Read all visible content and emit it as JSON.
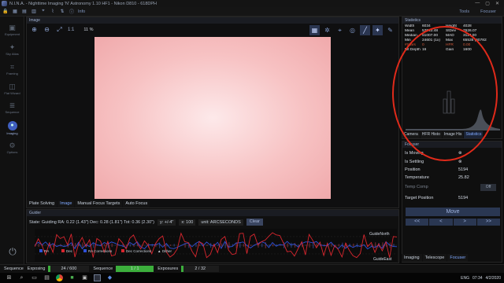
{
  "window": {
    "title": "N.I.N.A. - Nighttime Imaging 'N' Astronomy 1.10 HF1 - Nikon D810 - 618DPH",
    "min": "—",
    "max": "▢",
    "close": "✕"
  },
  "toolbar": {
    "info_label": "Info",
    "tools_label": "Tools",
    "right_label": "Focuser"
  },
  "nav": [
    {
      "label": "Equipment",
      "icon": "camera-icon"
    },
    {
      "label": "Sky Atlas",
      "icon": "atlas-icon"
    },
    {
      "label": "Framing",
      "icon": "framing-icon"
    },
    {
      "label": "Flat Wizard",
      "icon": "flat-icon"
    },
    {
      "label": "Sequence",
      "icon": "sequence-icon"
    },
    {
      "label": "Imaging",
      "icon": "imaging-icon"
    },
    {
      "label": "Options",
      "icon": "gear-icon"
    }
  ],
  "image_panel": {
    "header": "Image",
    "ratio": "1:1",
    "zoom": "11 %",
    "tabs": [
      "Plate Solving",
      "Image",
      "Manual Focus Targets",
      "Auto Focus"
    ]
  },
  "guider": {
    "header": "Guider",
    "state": "State: Guiding  RA: 0.22 (1.43\")  Dec: 0.28 (1.81\")  Tot: 0.36 (2.30\")",
    "y_scale": "y: +/-4\"",
    "x_scale": "x: 100",
    "unit": "unit: ARCSECONDS",
    "clear": "Clear",
    "guide_north": "GuideNorth",
    "guide_east": "GuideEast",
    "legend": [
      "RA",
      "Dec",
      "RA Corrections",
      "Dec Corrections",
      "Dither"
    ]
  },
  "statistics": {
    "header": "Statistics",
    "rows": [
      [
        "Width",
        "6034",
        "Height",
        "4028"
      ],
      [
        "Mean",
        "53543.48",
        "StDev",
        "7626.07"
      ],
      [
        "Median",
        "51007.00",
        "MAD",
        "3117.00"
      ],
      [
        "Min",
        "24601 (1x)",
        "Max",
        "65535 (60782x)"
      ],
      [
        "#Stars",
        "0",
        "HFR",
        "0.00"
      ],
      [
        "Bit Depth",
        "16",
        "Gain",
        "1600"
      ]
    ],
    "tabs": [
      "Camera",
      "HFR Histo",
      "Image His",
      "Statistics"
    ]
  },
  "focuser": {
    "header": "Focuser",
    "is_moving_label": "Is Moving",
    "is_settling_label": "Is Settling",
    "position_label": "Position",
    "position_value": "5194",
    "temperature_label": "Temperature",
    "temperature_value": "25.82",
    "temp_comp_label": "Temp Comp",
    "temp_comp_value": "Off",
    "target_label": "Target Position",
    "target_value": "5194",
    "move_label": "Move",
    "arrows": [
      "<<",
      "<",
      ">",
      ">>"
    ]
  },
  "bottom_tabs": [
    "Imaging",
    "Telescope",
    "Focuser"
  ],
  "status": {
    "seq_label": "Sequence",
    "seq_state": "Exposing",
    "frames": "24 / 600",
    "frames_progress": 0.04,
    "seq2_label": "Sequence",
    "seq2_value": "1 / 1",
    "seq2_progress": 1.0,
    "exp_label": "Exposures",
    "exp_value": "2 / 32",
    "exp_progress": 0.0625
  },
  "taskbar": {
    "time": "07:34",
    "date": "4/2/2020",
    "lang": "ENG"
  },
  "colors": {
    "accent": "#3f5fbf",
    "ra": "#2e50d8",
    "dec": "#d8262e",
    "progress": "#3cae3c",
    "annotation": "#e02a1a"
  }
}
